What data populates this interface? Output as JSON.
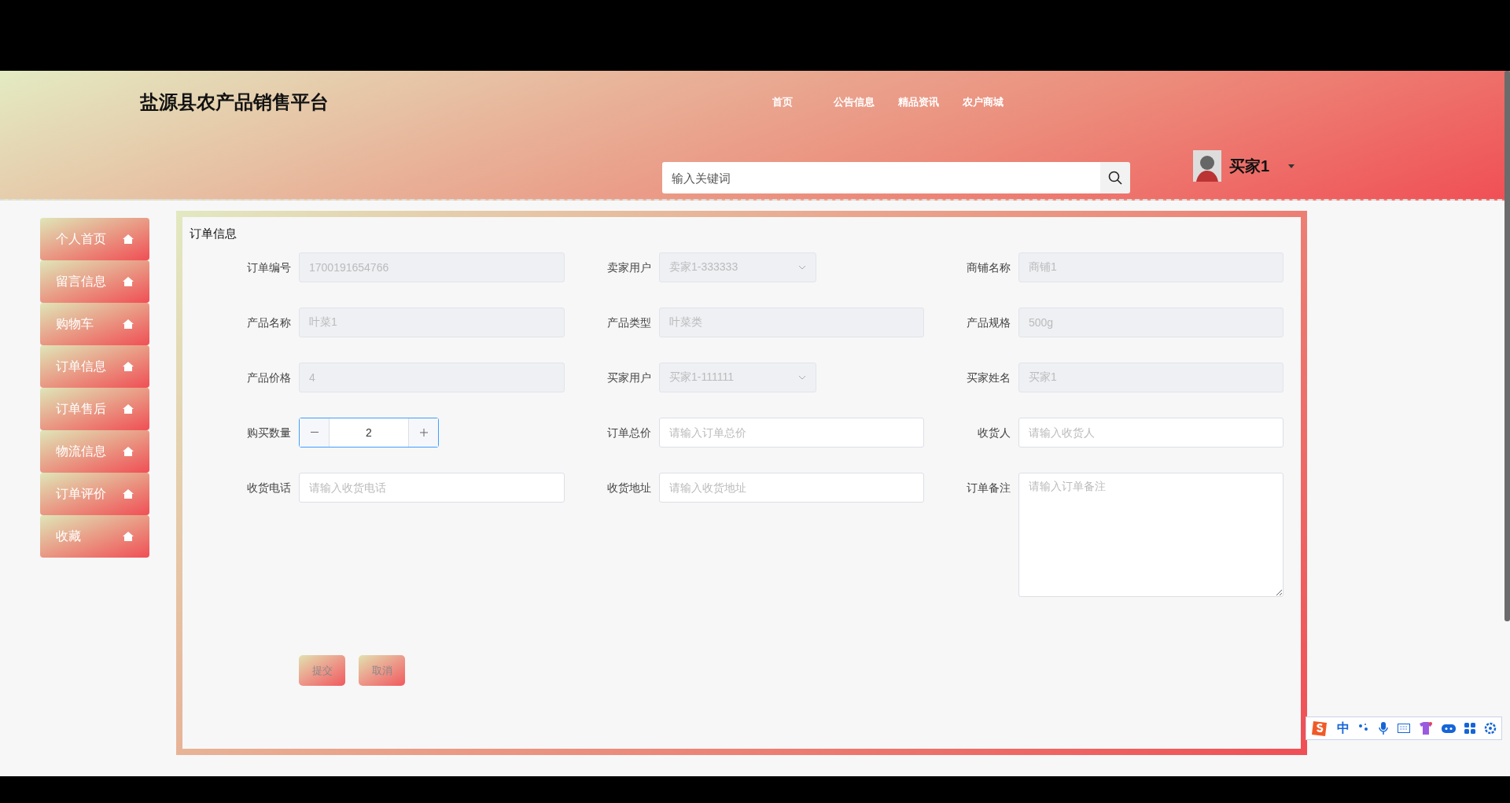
{
  "header": {
    "title": "盐源县农产品销售平台",
    "nav": [
      {
        "label": "首页"
      },
      {
        "label": "公告信息"
      },
      {
        "label": "精品资讯"
      },
      {
        "label": "农户商城"
      }
    ],
    "search": {
      "placeholder": "输入关键词"
    },
    "user": {
      "name": "买家1"
    }
  },
  "sidebar": {
    "items": [
      {
        "label": "个人首页"
      },
      {
        "label": "留言信息"
      },
      {
        "label": "购物车"
      },
      {
        "label": "订单信息"
      },
      {
        "label": "订单售后"
      },
      {
        "label": "物流信息"
      },
      {
        "label": "订单评价"
      },
      {
        "label": "收藏"
      }
    ]
  },
  "form": {
    "title": "订单信息",
    "fields": [
      {
        "label": "订单编号",
        "kind": "text",
        "disabled": true,
        "value": "1700191654766"
      },
      {
        "label": "卖家用户",
        "kind": "select",
        "disabled": true,
        "value": "卖家1-333333"
      },
      {
        "label": "商铺名称",
        "kind": "text",
        "disabled": true,
        "value": "商铺1"
      },
      {
        "label": "产品名称",
        "kind": "text",
        "disabled": true,
        "value": "叶菜1"
      },
      {
        "label": "产品类型",
        "kind": "text",
        "disabled": true,
        "value": "叶菜类"
      },
      {
        "label": "产品规格",
        "kind": "text",
        "disabled": true,
        "value": "500g"
      },
      {
        "label": "产品价格",
        "kind": "text",
        "disabled": true,
        "value": "4"
      },
      {
        "label": "买家用户",
        "kind": "select",
        "disabled": true,
        "value": "买家1-111111"
      },
      {
        "label": "买家姓名",
        "kind": "text",
        "disabled": true,
        "value": "买家1"
      },
      {
        "label": "购买数量",
        "kind": "number",
        "disabled": false,
        "value": "2"
      },
      {
        "label": "订单总价",
        "kind": "text",
        "disabled": false,
        "placeholder": "请输入订单总价"
      },
      {
        "label": "收货人",
        "kind": "text",
        "disabled": false,
        "placeholder": "请输入收货人"
      },
      {
        "label": "收货电话",
        "kind": "text",
        "disabled": false,
        "placeholder": "请输入收货电话"
      },
      {
        "label": "收货地址",
        "kind": "text",
        "disabled": false,
        "placeholder": "请输入收货地址"
      },
      {
        "label": "订单备注",
        "kind": "textarea",
        "disabled": false,
        "placeholder": "请输入订单备注"
      }
    ],
    "buttons": [
      "提交",
      "取消"
    ]
  },
  "ime_toolbar": {
    "mode": "中"
  }
}
